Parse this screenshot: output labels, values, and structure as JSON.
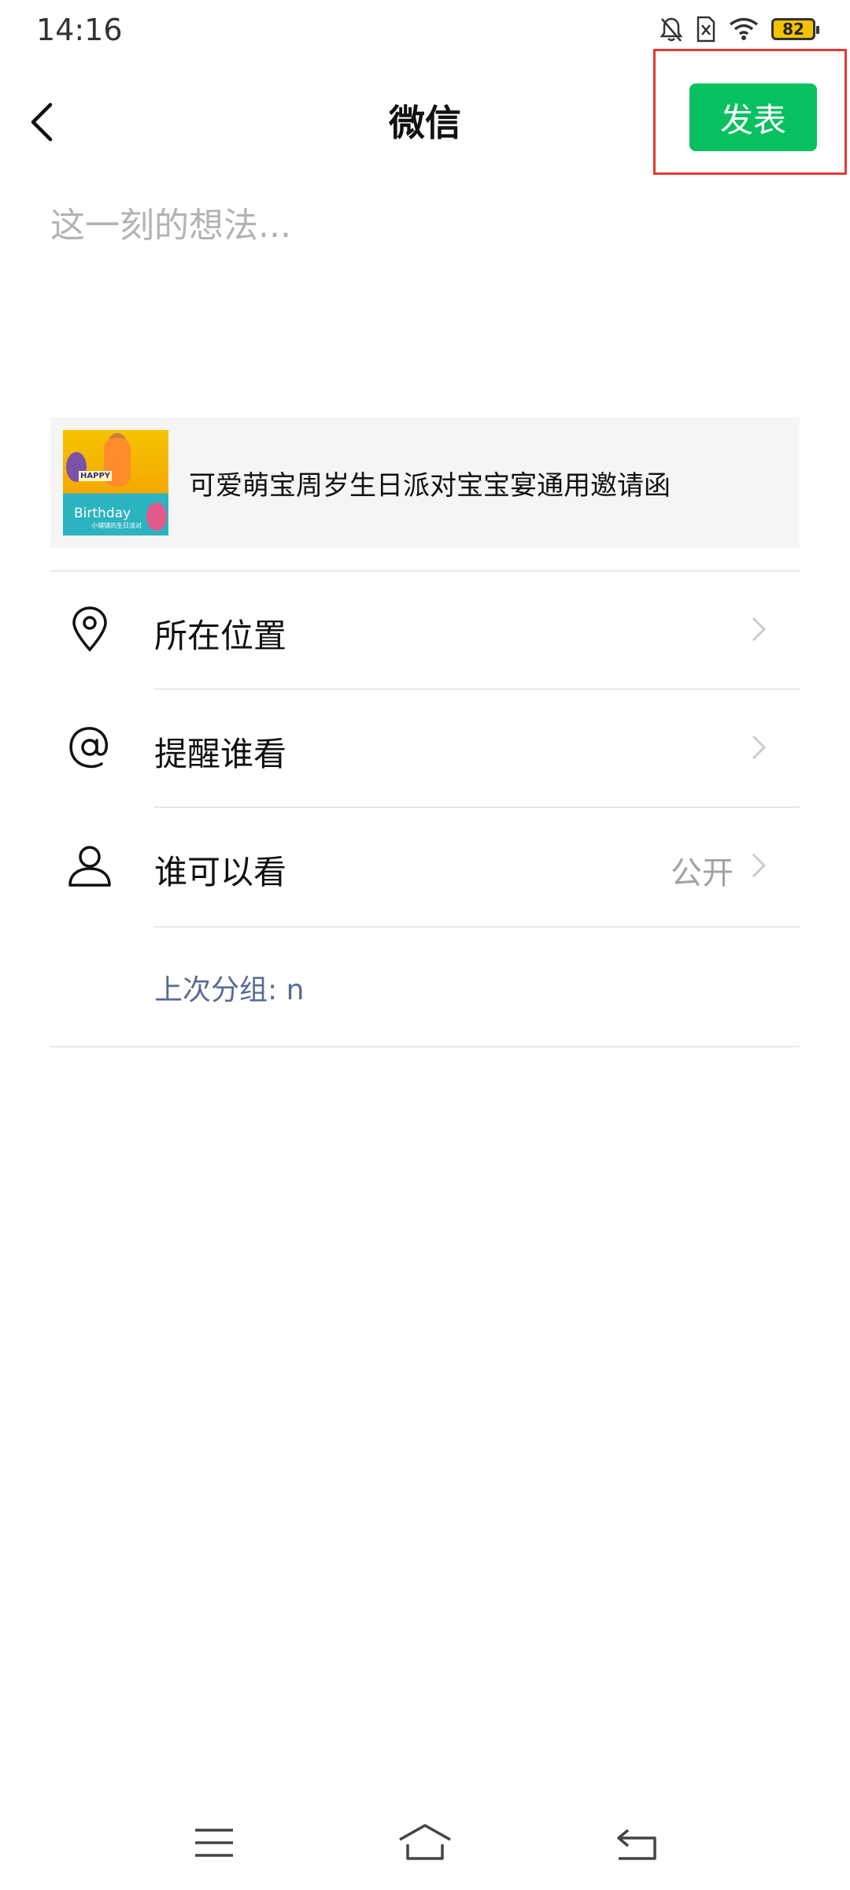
{
  "status_bar": {
    "time": "14:16",
    "battery_level": "82",
    "icons": [
      "bell-off-icon",
      "sim-off-icon",
      "wifi-icon",
      "battery-icon"
    ]
  },
  "header": {
    "title": "微信",
    "back_icon": "chevron-left-icon",
    "publish_label": "发表"
  },
  "composer": {
    "placeholder": "这一刻的想法...",
    "value": ""
  },
  "link_card": {
    "title": "可爱萌宝周岁生日派对宝宝宴通用邀请函",
    "thumbnail_text": "Birthday",
    "thumbnail_badge": "HAPPY",
    "thumbnail_caption": "小铺铺的生日派对"
  },
  "options": [
    {
      "label": "所在位置",
      "icon": "location-pin-icon",
      "value": ""
    },
    {
      "label": "提醒谁看",
      "icon": "at-sign-icon",
      "value": ""
    },
    {
      "label": "谁可以看",
      "icon": "person-icon",
      "value": "公开"
    }
  ],
  "last_group": "上次分组: n",
  "nav_bar": {
    "icons": [
      "menu-icon",
      "home-icon",
      "back-icon"
    ]
  },
  "colors": {
    "accent": "#07c160",
    "link": "#576b95",
    "highlight": "#e53935"
  }
}
